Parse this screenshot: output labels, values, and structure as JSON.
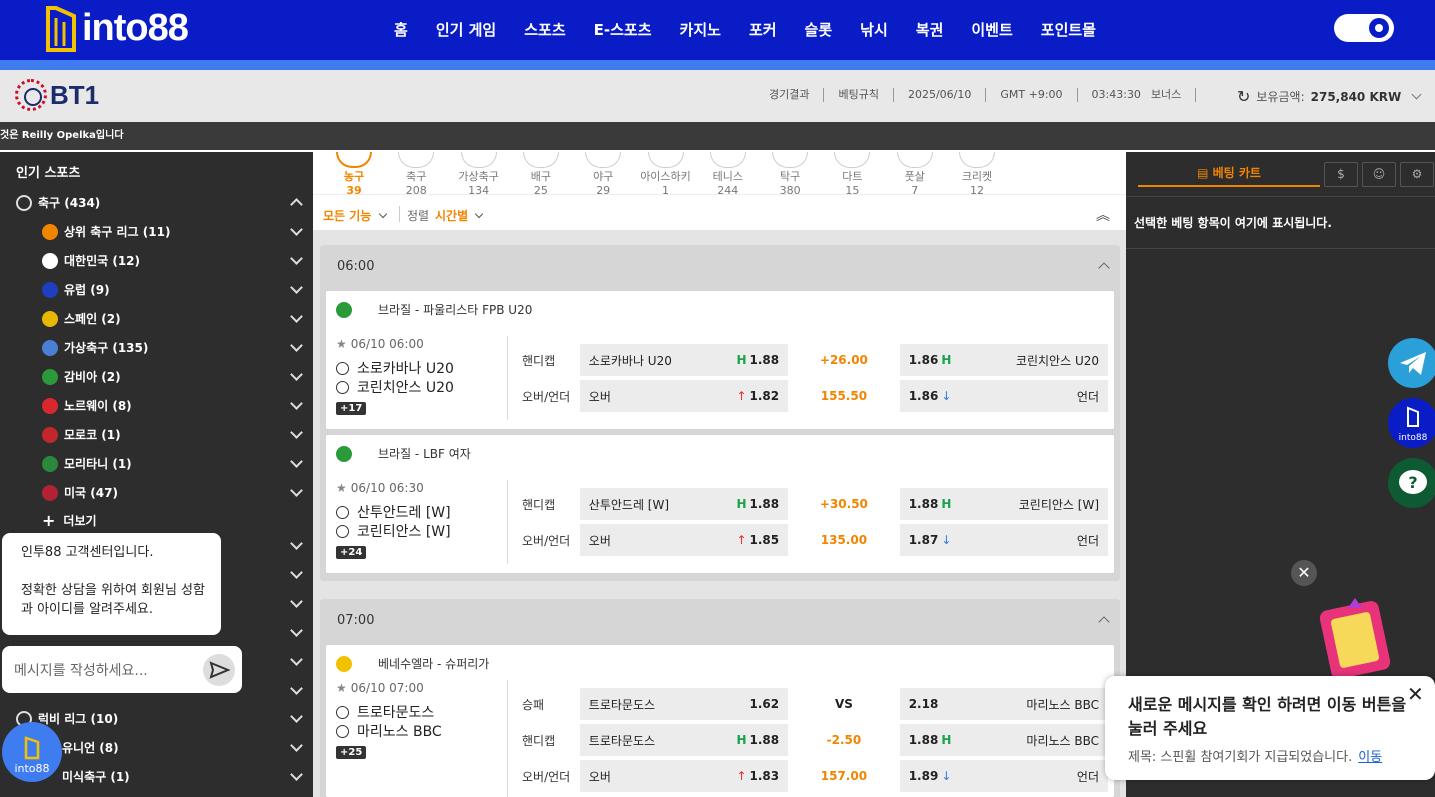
{
  "header": {
    "logo_text": "into88",
    "nav": [
      "홈",
      "인기 게임",
      "스포츠",
      "E-스포츠",
      "카지노",
      "포커",
      "슬롯",
      "낚시",
      "복권",
      "이벤트",
      "포인트몰"
    ]
  },
  "subbar": {
    "brand": "BT1",
    "results": "경기결과",
    "rules": "베팅규칙",
    "date": "2025/06/10",
    "timezone": "GMT +9:00",
    "time": "03:43:30",
    "bonus": "보너스",
    "balance_label": "보유금액:",
    "balance_value": "275,840 KRW"
  },
  "ticker": "것은 Reilly Opelka입니다",
  "left": {
    "title": "인기 스포츠",
    "soccer": "축구 (434)",
    "items": [
      {
        "label": "상위 축구 리그 (11)",
        "color": "#f28500"
      },
      {
        "label": "대한민국 (12)",
        "color": "#ffffff"
      },
      {
        "label": "유럽 (9)",
        "color": "#1e3fbf"
      },
      {
        "label": "스페인 (2)",
        "color": "#e8b800"
      },
      {
        "label": "가상축구 (135)",
        "color": "#4a7fd6"
      },
      {
        "label": "감비아 (2)",
        "color": "#2a9a3a"
      },
      {
        "label": "노르웨이 (8)",
        "color": "#d9272e"
      },
      {
        "label": "모로코 (1)",
        "color": "#c1272d"
      },
      {
        "label": "모리타니 (1)",
        "color": "#2a8a3a"
      },
      {
        "label": "미국 (47)",
        "color": "#b22234"
      }
    ],
    "more": "더보기",
    "rugby_league": "럭비 리그 (10)",
    "rugby_union": "유니언 (8)",
    "other": "미식축구 (1)"
  },
  "tabs": [
    {
      "name": "농구",
      "count": "39",
      "active": true
    },
    {
      "name": "축구",
      "count": "208"
    },
    {
      "name": "가상축구",
      "count": "134"
    },
    {
      "name": "배구",
      "count": "25"
    },
    {
      "name": "야구",
      "count": "29"
    },
    {
      "name": "아이스하키",
      "count": "1"
    },
    {
      "name": "테니스",
      "count": "244"
    },
    {
      "name": "탁구",
      "count": "380"
    },
    {
      "name": "다트",
      "count": "15"
    },
    {
      "name": "풋살",
      "count": "7"
    },
    {
      "name": "크리켓",
      "count": "12"
    }
  ],
  "filter": {
    "all": "모든 기능",
    "sort_label": "정렬",
    "sort_value": "시간별"
  },
  "groups": [
    {
      "time": "06:00",
      "matches": [
        {
          "league": "브라질 - 파울리스타 FPB U20",
          "flag": "#2a9a3a",
          "datetime": "06/10  06:00",
          "home": "소로카바나 U20",
          "away": "코린치안스 U20",
          "more": "+17",
          "rows": [
            {
              "label": "핸디캡",
              "left": "소로카바나 U20",
              "lprefix": "H",
              "lodds": "1.88",
              "mid": "+26.00",
              "rodds": "1.86",
              "rsuffix": "H",
              "right": "코린치안스 U20"
            },
            {
              "label": "오버/언더",
              "left": "오버",
              "lprefix": "↑",
              "lodds": "1.82",
              "mid": "155.50",
              "rodds": "1.86",
              "rsuffix": "↓",
              "right": "언더"
            }
          ]
        },
        {
          "league": "브라질 - LBF 여자",
          "flag": "#2a9a3a",
          "datetime": "06/10  06:30",
          "home": "산투안드레 [W]",
          "away": "코린티안스 [W]",
          "more": "+24",
          "rows": [
            {
              "label": "핸디캡",
              "left": "산투안드레 [W]",
              "lprefix": "H",
              "lodds": "1.88",
              "mid": "+30.50",
              "rodds": "1.88",
              "rsuffix": "H",
              "right": "코린티안스 [W]"
            },
            {
              "label": "오버/언더",
              "left": "오버",
              "lprefix": "↑",
              "lodds": "1.85",
              "mid": "135.00",
              "rodds": "1.87",
              "rsuffix": "↓",
              "right": "언더"
            }
          ]
        }
      ]
    },
    {
      "time": "07:00",
      "matches": [
        {
          "league": "베네수엘라 - 슈퍼리가",
          "flag": "#f2c200",
          "datetime": "06/10  07:00",
          "home": "트로타문도스",
          "away": "마리노스 BBC",
          "more": "+25",
          "rows": [
            {
              "label": "승패",
              "left": "트로타문도스",
              "lprefix": "",
              "lodds": "1.62",
              "mid": "VS",
              "rodds": "2.18",
              "rsuffix": "",
              "right": "마리노스 BBC"
            },
            {
              "label": "핸디캡",
              "left": "트로타문도스",
              "lprefix": "H",
              "lodds": "1.88",
              "mid": "-2.50",
              "rodds": "1.88",
              "rsuffix": "H",
              "right": "마리노스 BBC"
            },
            {
              "label": "오버/언더",
              "left": "오버",
              "lprefix": "↑",
              "lodds": "1.83",
              "mid": "157.00",
              "rodds": "1.89",
              "rsuffix": "↓",
              "right": "언더"
            }
          ]
        }
      ]
    }
  ],
  "betslip": {
    "tab": "베팅 카트",
    "message": "선택한 베팅 항목이 여기에 표시됩니다."
  },
  "chat": {
    "greeting": "인투88 고객센터입니다.",
    "body": "정확한 상담을 위하여 회원님 성함과 아이디를 알려주세요.",
    "placeholder": "메시지를 작성하세요..."
  },
  "float_logo": "into88",
  "notice": {
    "title": "새로운 메시지를 확인 하려면 이동 버튼을 눌러 주세요",
    "body": "제목: 스핀휠 참여기회가 지급되었습니다.",
    "link": "이동"
  }
}
